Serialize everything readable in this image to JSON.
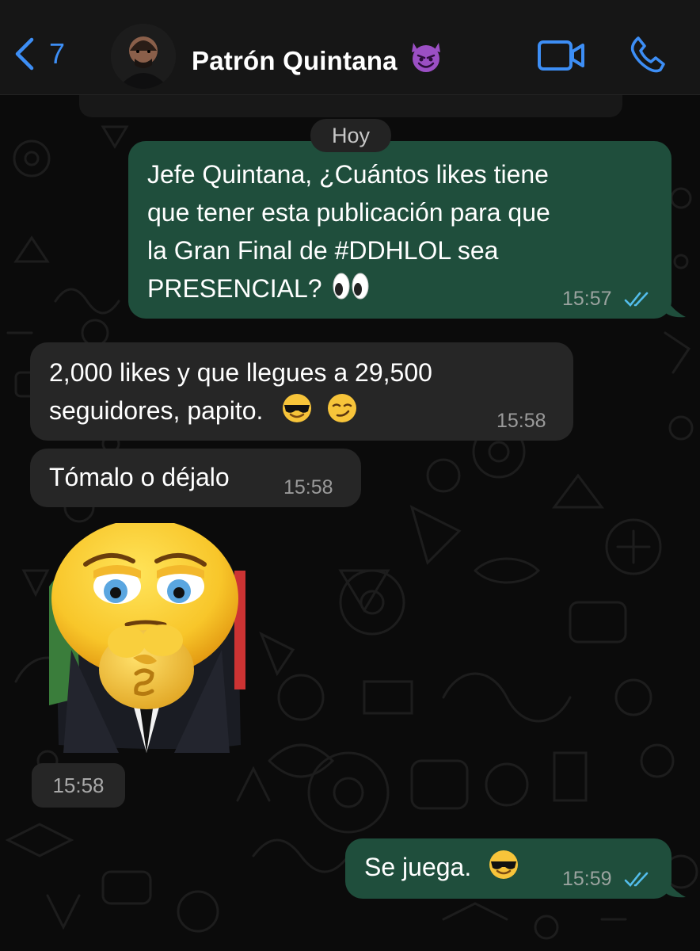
{
  "header": {
    "back_count": "7",
    "contact_name": "Patrón Quintana",
    "contact_emoji": "smiling-imp-emoji"
  },
  "date_divider": "Hoy",
  "messages": [
    {
      "direction": "out",
      "lines": [
        "Jefe Quintana, ¿Cuántos likes tiene",
        "que tener esta publicación para que",
        "la Gran Final de #DDHLOL sea",
        "PRESENCIAL?"
      ],
      "trailing_emoji": "eyes-emoji",
      "time": "15:57",
      "status": "read"
    },
    {
      "direction": "in",
      "lines": [
        "2,000 likes y que llegues a 29,500",
        "seguidores, papito."
      ],
      "trailing_emoji": "sunglasses-smirk-emojis",
      "time": "15:58"
    },
    {
      "direction": "in",
      "lines": [
        "Tómalo o déjalo"
      ],
      "time": "15:58"
    },
    {
      "direction": "in",
      "type": "sticker",
      "sticker": "money-rubbing-emoji-sticker",
      "time": "15:58"
    },
    {
      "direction": "out",
      "lines": [
        "Se juega."
      ],
      "trailing_emoji": "sunglasses-emoji",
      "time": "15:59",
      "status": "read"
    }
  ],
  "colors": {
    "accent": "#3d8ef5",
    "outgoing_bubble": "#1f4e3c",
    "incoming_bubble": "#262626",
    "read_ticks": "#53bdeb"
  }
}
